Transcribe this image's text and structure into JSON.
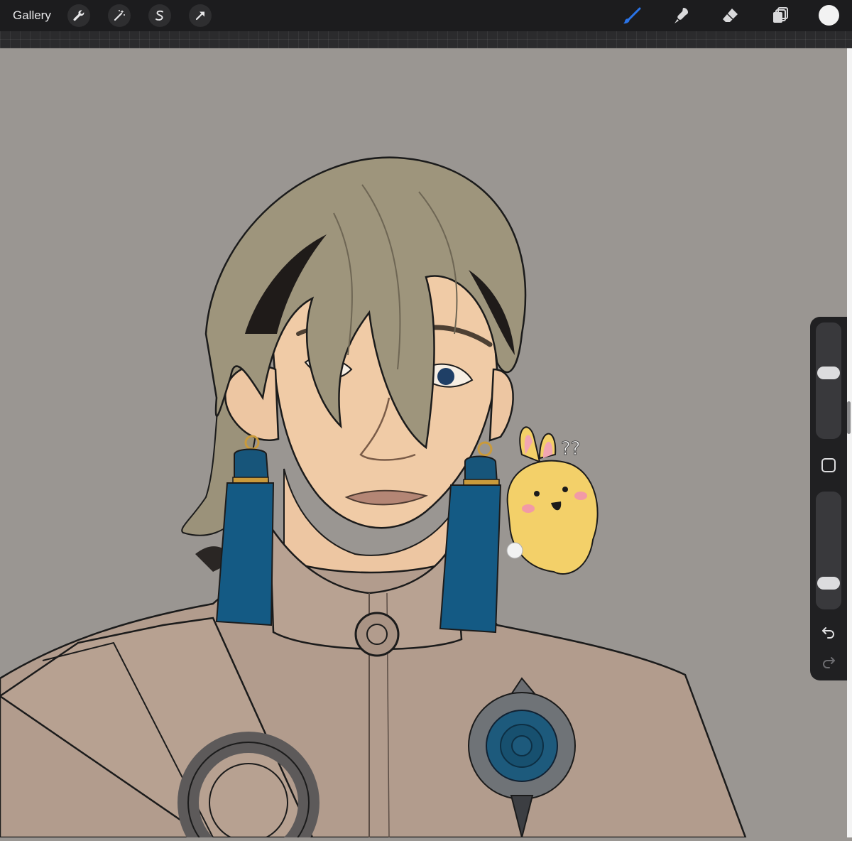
{
  "toolbar": {
    "gallery_label": "Gallery",
    "left_tools": [
      "wrench-icon",
      "magic-wand-icon",
      "selection-s-icon",
      "transform-arrow-icon"
    ],
    "right_tools": [
      "brush-icon",
      "smudge-icon",
      "eraser-icon",
      "layers-icon"
    ],
    "active_tool": "brush-icon",
    "active_color": "#2a74e8",
    "current_color": "#f2f2f2"
  },
  "sidebar": {
    "brush_size_level": 0.58,
    "opacity_level": 0.18,
    "buttons": [
      "modifier-square-icon",
      "undo-icon",
      "redo-icon"
    ]
  },
  "canvas": {
    "background": "#9a9692",
    "artwork": "illustration",
    "annotation_text": "??"
  }
}
